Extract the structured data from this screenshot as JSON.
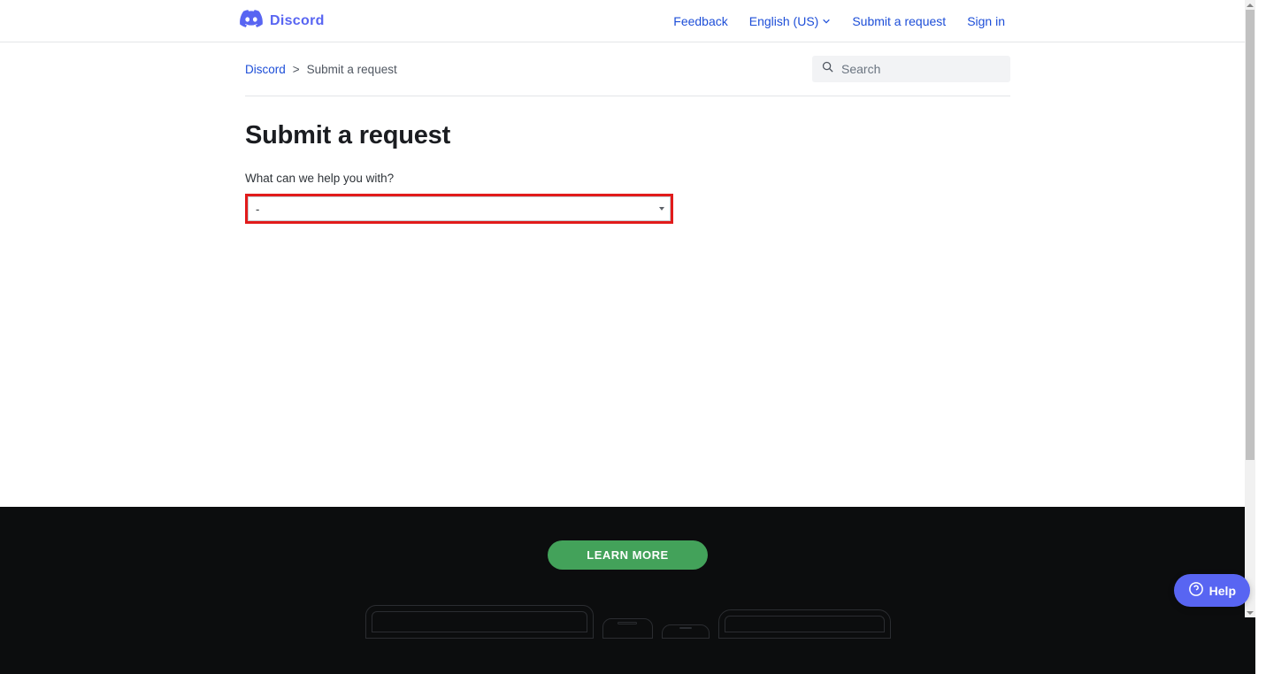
{
  "brand": {
    "name": "Discord"
  },
  "nav": {
    "feedback": "Feedback",
    "language": "English (US)",
    "submit_request": "Submit a request",
    "sign_in": "Sign in"
  },
  "breadcrumb": {
    "root": "Discord",
    "separator": ">",
    "current": "Submit a request"
  },
  "search": {
    "placeholder": "Search"
  },
  "page": {
    "title": "Submit a request"
  },
  "form": {
    "help_label": "What can we help you with?",
    "selected_value": "-"
  },
  "footer": {
    "learn_more": "LEARN MORE"
  },
  "help_widget": {
    "label": "Help"
  }
}
